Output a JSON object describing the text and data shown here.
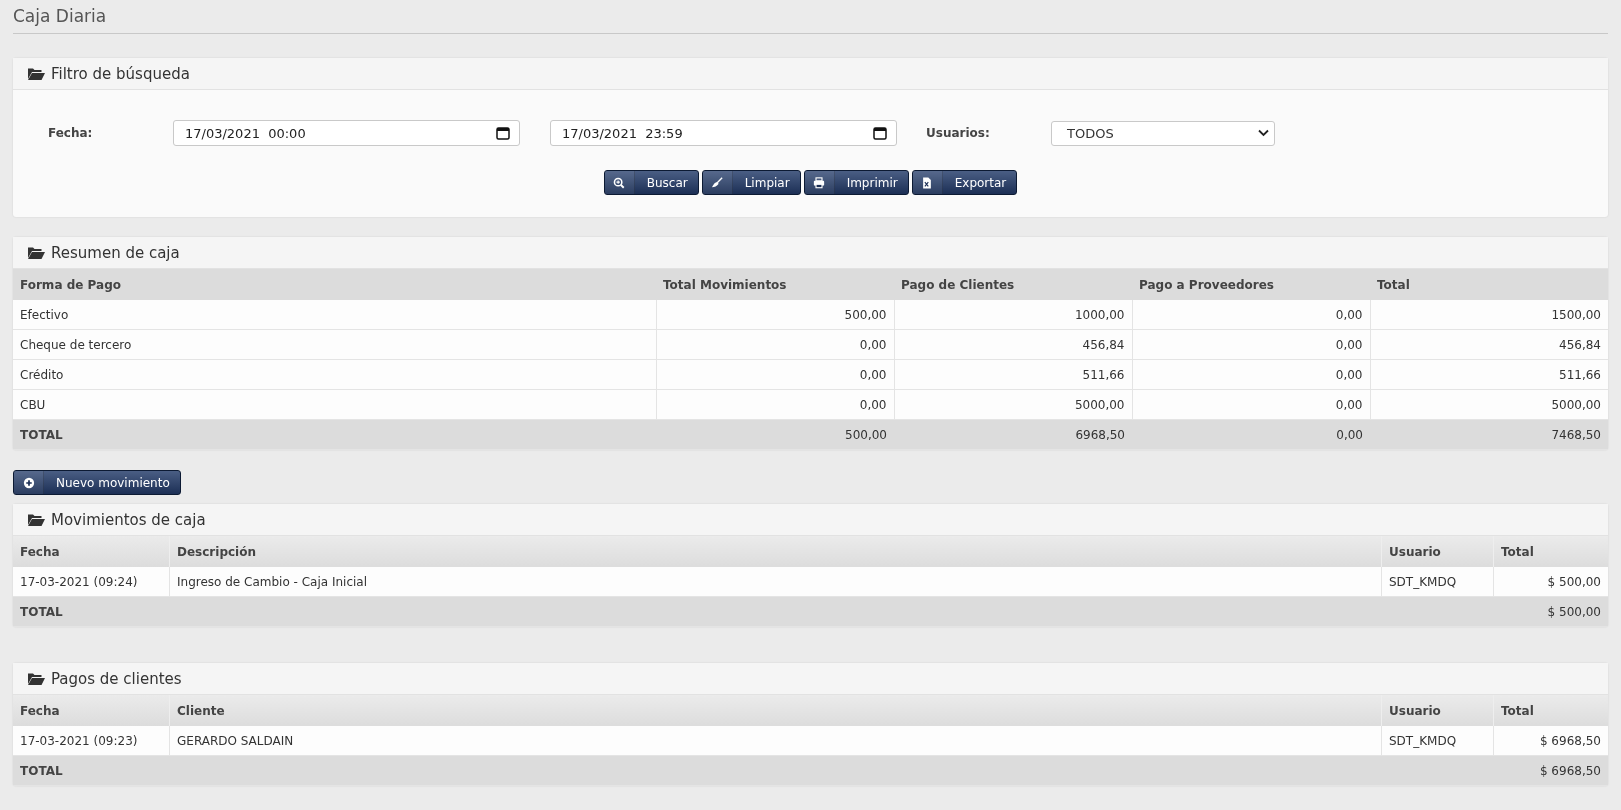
{
  "page_title": "Caja Diaria",
  "filter": {
    "title": "Filtro de búsqueda",
    "date_label": "Fecha:",
    "date_from": "17/03/2021  00:00",
    "date_to": "17/03/2021  23:59",
    "users_label": "Usuarios:",
    "users_value": "TODOS",
    "buttons": [
      {
        "kind": "search",
        "label": "Buscar"
      },
      {
        "kind": "clear",
        "label": "Limpiar"
      },
      {
        "kind": "print",
        "label": "Imprimir"
      },
      {
        "kind": "export",
        "label": "Exportar"
      }
    ]
  },
  "summary": {
    "title": "Resumen de caja",
    "columns": [
      "Forma de Pago",
      "Total Movimientos",
      "Pago de Clientes",
      "Pago a Proveedores",
      "Total"
    ],
    "rows": [
      [
        "Efectivo",
        "500,00",
        "1000,00",
        "0,00",
        "1500,00"
      ],
      [
        "Cheque de tercero",
        "0,00",
        "456,84",
        "0,00",
        "456,84"
      ],
      [
        "Crédito",
        "0,00",
        "511,66",
        "0,00",
        "511,66"
      ],
      [
        "CBU",
        "0,00",
        "5000,00",
        "0,00",
        "5000,00"
      ]
    ],
    "total": [
      "TOTAL",
      "500,00",
      "6968,50",
      "0,00",
      "7468,50"
    ]
  },
  "new_button": {
    "kind": "add",
    "label": "Nuevo movimiento"
  },
  "movements": {
    "title": "Movimientos de caja",
    "columns": [
      "Fecha",
      "Descripción",
      "Usuario",
      "Total"
    ],
    "rows": [
      [
        "17-03-2021 (09:24)",
        "Ingreso de Cambio - Caja Inicial",
        "SDT_KMDQ",
        "$ 500,00"
      ]
    ],
    "total": [
      "TOTAL",
      "$ 500,00"
    ]
  },
  "payments": {
    "title": "Pagos de clientes",
    "columns": [
      "Fecha",
      "Cliente",
      "Usuario",
      "Total"
    ],
    "rows": [
      [
        "17-03-2021 (09:23)",
        "GERARDO SALDAIN",
        "SDT_KMDQ",
        "$ 6968,50"
      ]
    ],
    "total": [
      "TOTAL",
      "$ 6968,50"
    ]
  }
}
